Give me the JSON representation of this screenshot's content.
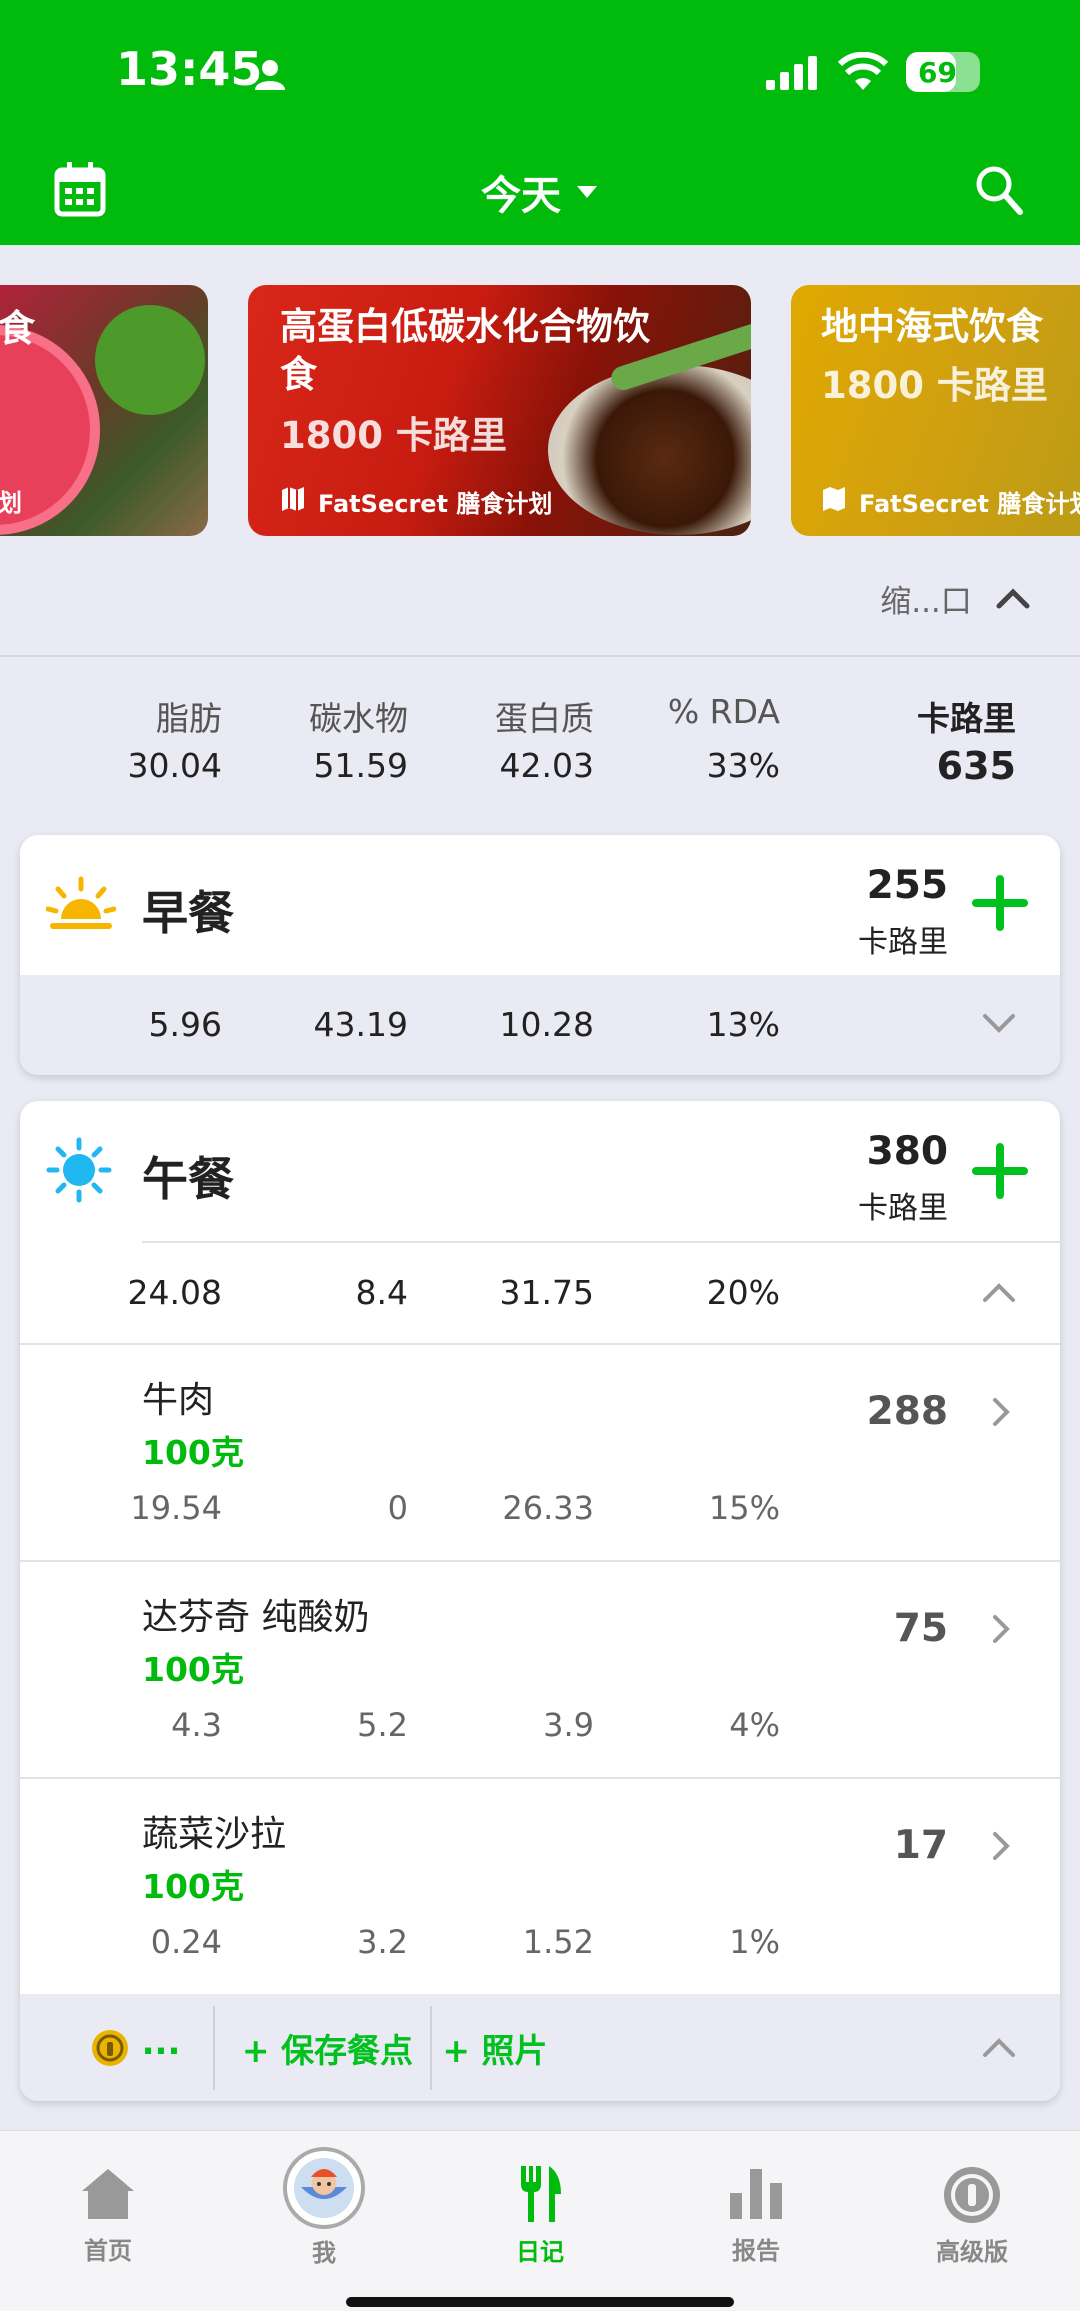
{
  "status_bar": {
    "time": "13:45",
    "battery": "69"
  },
  "app_bar": {
    "date_label": "今天"
  },
  "banners": [
    {
      "title": "食",
      "calories": "",
      "source": "划"
    },
    {
      "title": "高蛋白低碳水化合物饮食",
      "calories": "1800 卡路里",
      "source": "FatSecret 膳食计划"
    },
    {
      "title": "地中海式饮食",
      "calories": "1800 卡路里",
      "source": "FatSecret 膳食计划"
    }
  ],
  "collapse_label": "缩...口",
  "summary": {
    "headers": {
      "fat": "脂肪",
      "carbs": "碳水物",
      "protein": "蛋白质",
      "rda": "% RDA",
      "calories": "卡路里"
    },
    "values": {
      "fat": "30.04",
      "carbs": "51.59",
      "protein": "42.03",
      "rda": "33%",
      "calories": "635"
    }
  },
  "meals": [
    {
      "name": "早餐",
      "calories": "255",
      "unit": "卡路里",
      "macros": {
        "fat": "5.96",
        "carbs": "43.19",
        "protein": "10.28",
        "rda": "13%"
      }
    },
    {
      "name": "午餐",
      "calories": "380",
      "unit": "卡路里",
      "macros": {
        "fat": "24.08",
        "carbs": "8.4",
        "protein": "31.75",
        "rda": "20%"
      },
      "foods": [
        {
          "name": "牛肉",
          "amount": "100克",
          "calories": "288",
          "fat": "19.54",
          "carbs": "0",
          "protein": "26.33",
          "rda": "15%"
        },
        {
          "name": "达芬奇 纯酸奶",
          "amount": "100克",
          "calories": "75",
          "fat": "4.3",
          "carbs": "5.2",
          "protein": "3.9",
          "rda": "4%"
        },
        {
          "name": "蔬菜沙拉",
          "amount": "100克",
          "calories": "17",
          "fat": "0.24",
          "carbs": "3.2",
          "protein": "1.52",
          "rda": "1%"
        }
      ],
      "footer": {
        "more": "...",
        "save_meal": "+ 保存餐点",
        "photo": "+ 照片"
      }
    }
  ],
  "tabs": [
    {
      "label": "首页",
      "icon": "home-icon"
    },
    {
      "label": "我",
      "icon": "avatar-icon"
    },
    {
      "label": "日记",
      "icon": "fork-knife-icon"
    },
    {
      "label": "报告",
      "icon": "bar-chart-icon"
    },
    {
      "label": "高级版",
      "icon": "premium-icon"
    }
  ],
  "colors": {
    "primary_green": "#00bb0c",
    "add_green": "#00c11e",
    "background": "#e9eaf3"
  }
}
